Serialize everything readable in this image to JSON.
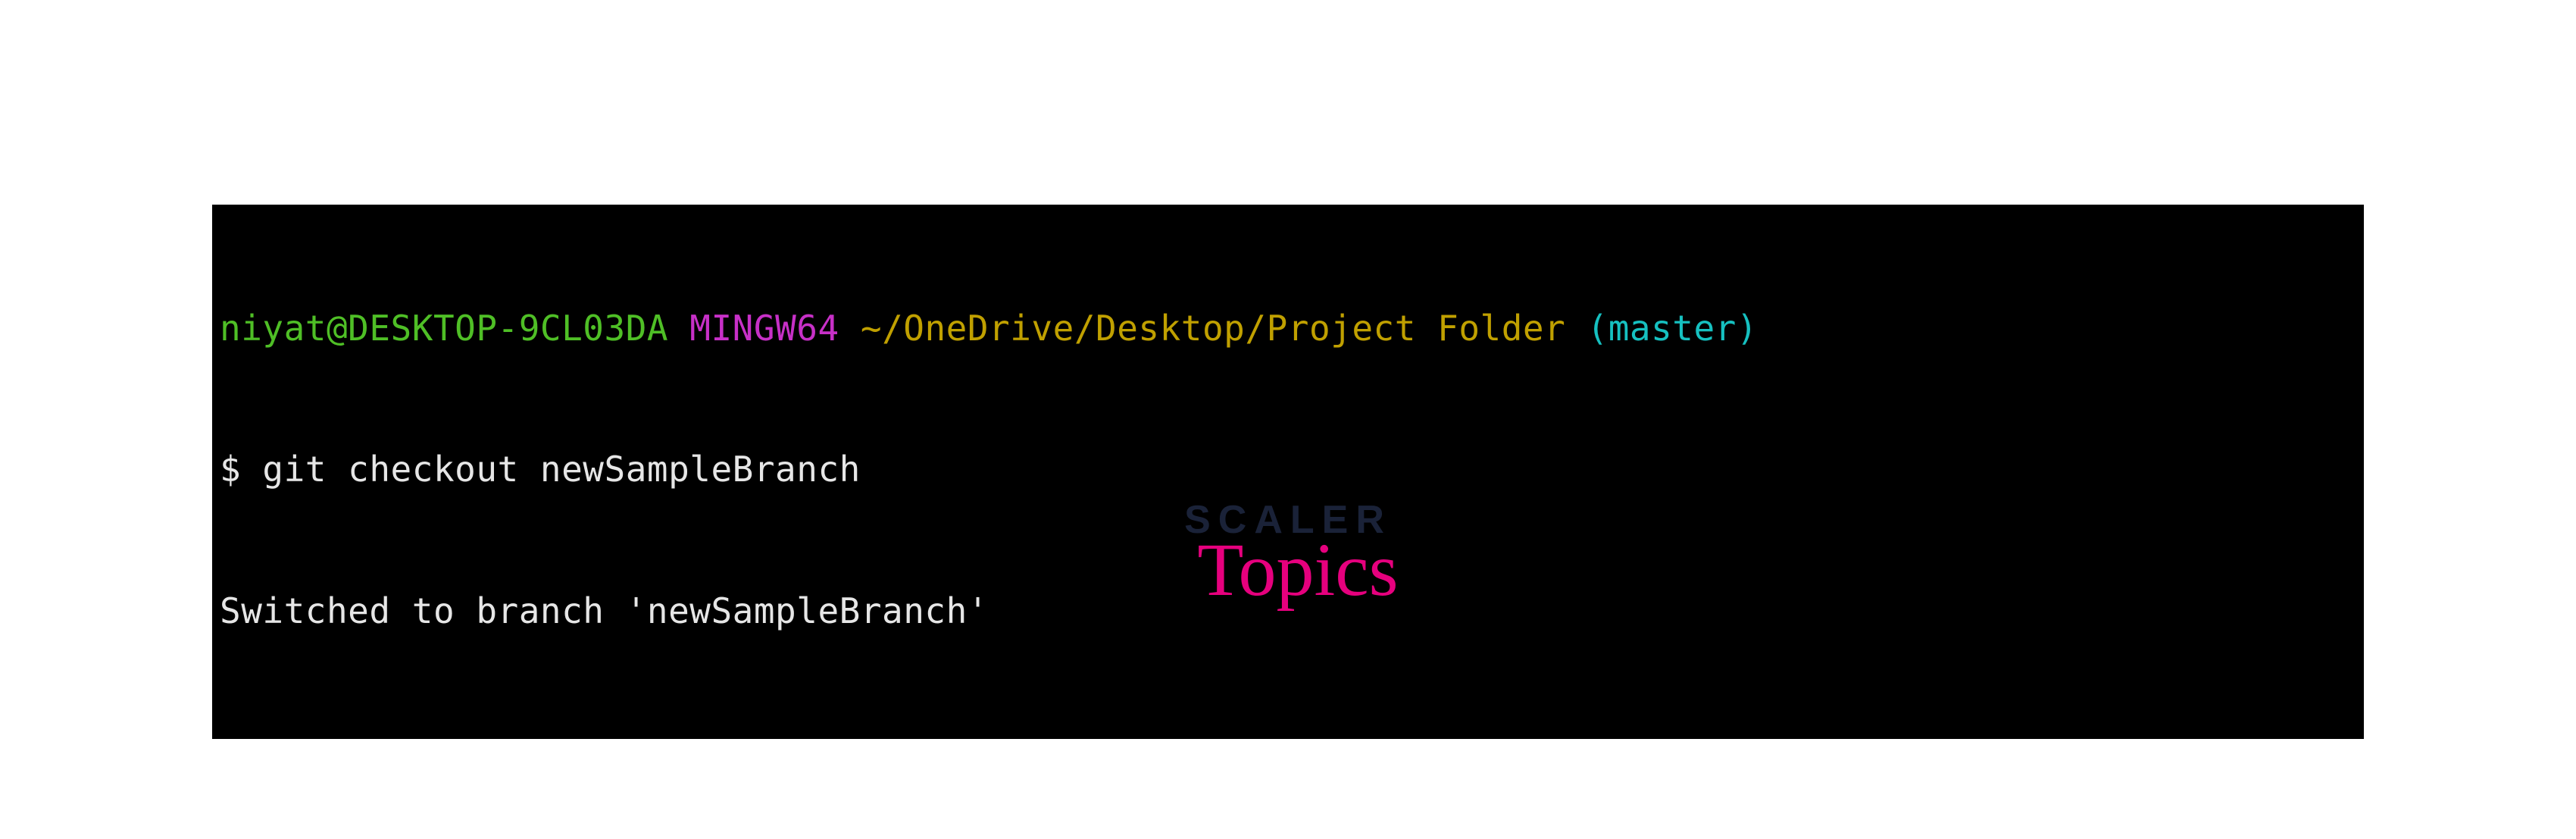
{
  "terminal": {
    "prompt": {
      "user_host": "niyat@DESKTOP-9CL03DA",
      "env": "MINGW64",
      "path": "~/OneDrive/Desktop/Project Folder",
      "branch_open": "(",
      "branch": "master",
      "branch_close": ")"
    },
    "command_line": {
      "symbol": "$ ",
      "command": "git checkout newSampleBranch"
    },
    "output": "Switched to branch 'newSampleBranch'"
  },
  "brand": {
    "line1": "SCALER",
    "line2": "Topics"
  },
  "colors": {
    "terminal_bg": "#000000",
    "green": "#4fbf26",
    "magenta": "#c730c7",
    "yellow": "#c0a000",
    "cyan": "#16c0c0",
    "white": "#e6e6e6",
    "brand_dark": "#1a2238",
    "brand_pink": "#e6007e"
  }
}
